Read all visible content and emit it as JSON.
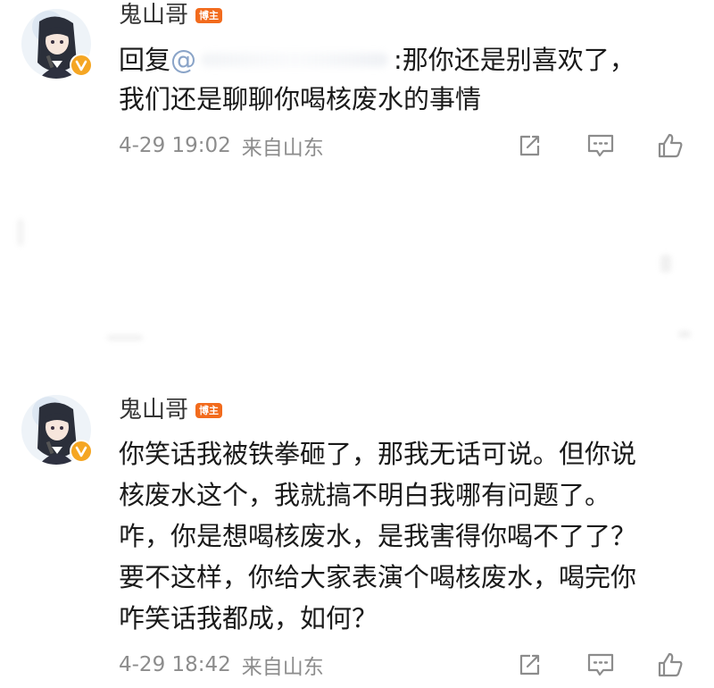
{
  "comments": [
    {
      "username": "鬼山哥",
      "badge": "博主",
      "reply_prefix": "回复",
      "at_sign": "@",
      "text_line1": ":那你还是别喜欢了，",
      "text_line2": "我们还是聊聊你喝核废水的事情",
      "timestamp": "4-29 19:02",
      "location": "来自山东",
      "icons": [
        "share-icon",
        "comment-icon",
        "like-icon"
      ]
    },
    {
      "username": "鬼山哥",
      "badge": "博主",
      "lines": [
        "你笑话我被铁拳砸了，那我无话可说。但你说",
        "核废水这个，我就搞不明白我哪有问题了。",
        "咋，你是想喝核废水，是我害得你喝不了了？",
        "要不这样，你给大家表演个喝核废水，喝完你",
        "咋笑话我都成，如何？"
      ],
      "timestamp": "4-29 18:42",
      "location": "来自山东",
      "icons": [
        "share-icon",
        "comment-icon",
        "like-icon"
      ]
    }
  ],
  "colors": {
    "badge_bg": "#f26b1d",
    "verified": "#f5a623",
    "meta_text": "#8c8c8c",
    "mention": "#8aa4c8"
  }
}
